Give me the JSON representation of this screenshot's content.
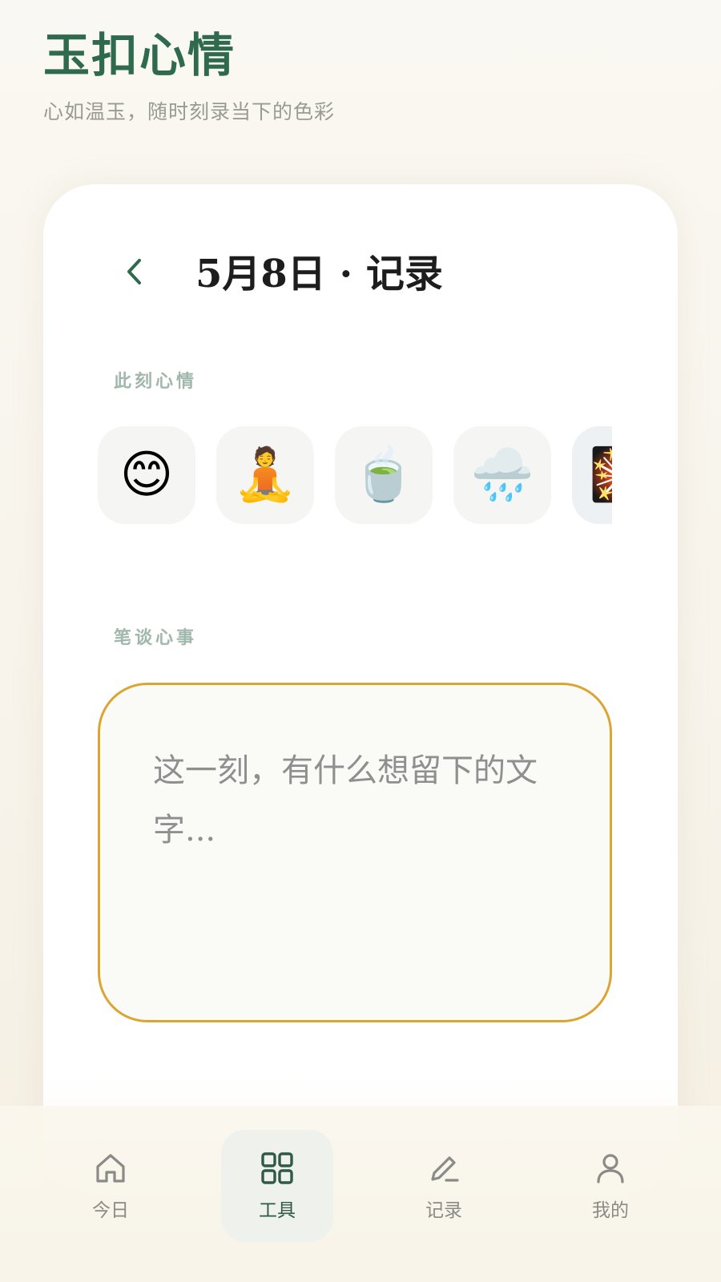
{
  "header": {
    "title": "玉扣心情",
    "subtitle": "心如温玉，随时刻录当下的色彩"
  },
  "card": {
    "back_icon": "chevron-left-icon",
    "title": "5月8日 · 记录",
    "mood_label": "此刻心情",
    "moods": [
      {
        "emoji": "😊",
        "icon": "smiling-face-icon"
      },
      {
        "emoji": "🧘",
        "icon": "meditation-icon"
      },
      {
        "emoji": "🍵",
        "icon": "tea-icon"
      },
      {
        "emoji": "🌧️",
        "icon": "rain-cloud-icon"
      },
      {
        "emoji": "🎇",
        "icon": "sparkler-icon"
      }
    ],
    "notes_label": "笔谈心事",
    "notes_placeholder": "这一刻，有什么想留下的文字..."
  },
  "tabs": [
    {
      "label": "今日",
      "icon": "home-icon"
    },
    {
      "label": "工具",
      "icon": "grid-icon",
      "active": true
    },
    {
      "label": "记录",
      "icon": "pen-icon"
    },
    {
      "label": "我的",
      "icon": "user-icon"
    }
  ],
  "colors": {
    "brand": "#2f6a4f",
    "accent_border": "#dba532",
    "section_label": "#9fb8ab"
  }
}
